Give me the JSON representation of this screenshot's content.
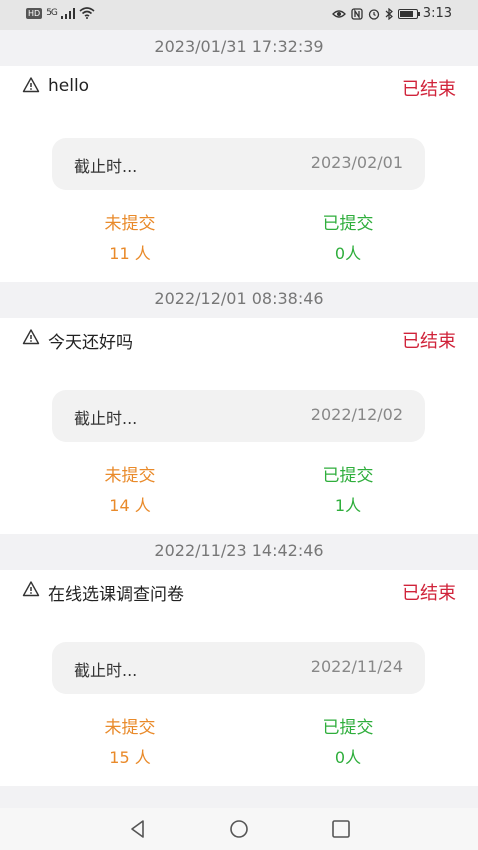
{
  "status_bar": {
    "hd_badge": "HD",
    "network": "5G",
    "time": "3:13",
    "battery_level": 0.85
  },
  "surveys": [
    {
      "created": "2023/01/31 17:32:39",
      "title": "hello",
      "status": "已结束",
      "deadline_label": "截止时...",
      "deadline": "2023/02/01",
      "pending_label": "未提交",
      "pending_count": "11 人",
      "submitted_label": "已提交",
      "submitted_count": "0人"
    },
    {
      "created": "2022/12/01 08:38:46",
      "title": "今天还好吗",
      "status": "已结束",
      "deadline_label": "截止时...",
      "deadline": "2022/12/02",
      "pending_label": "未提交",
      "pending_count": "14 人",
      "submitted_label": "已提交",
      "submitted_count": "1人"
    },
    {
      "created": "2022/11/23 14:42:46",
      "title": "在线选课调查问卷",
      "status": "已结束",
      "deadline_label": "截止时...",
      "deadline": "2022/11/24",
      "pending_label": "未提交",
      "pending_count": "15 人",
      "submitted_label": "已提交",
      "submitted_count": "0人"
    }
  ],
  "colors": {
    "status_ended": "#d0233a",
    "pending": "#e98a2a",
    "submitted": "#2fae3c"
  },
  "icons": [
    "warning-icon",
    "back-icon",
    "home-icon",
    "recents-icon",
    "eye-icon",
    "nfc-icon",
    "alarm-icon",
    "bluetooth-icon",
    "wifi-icon",
    "signal-icon",
    "battery-icon"
  ]
}
